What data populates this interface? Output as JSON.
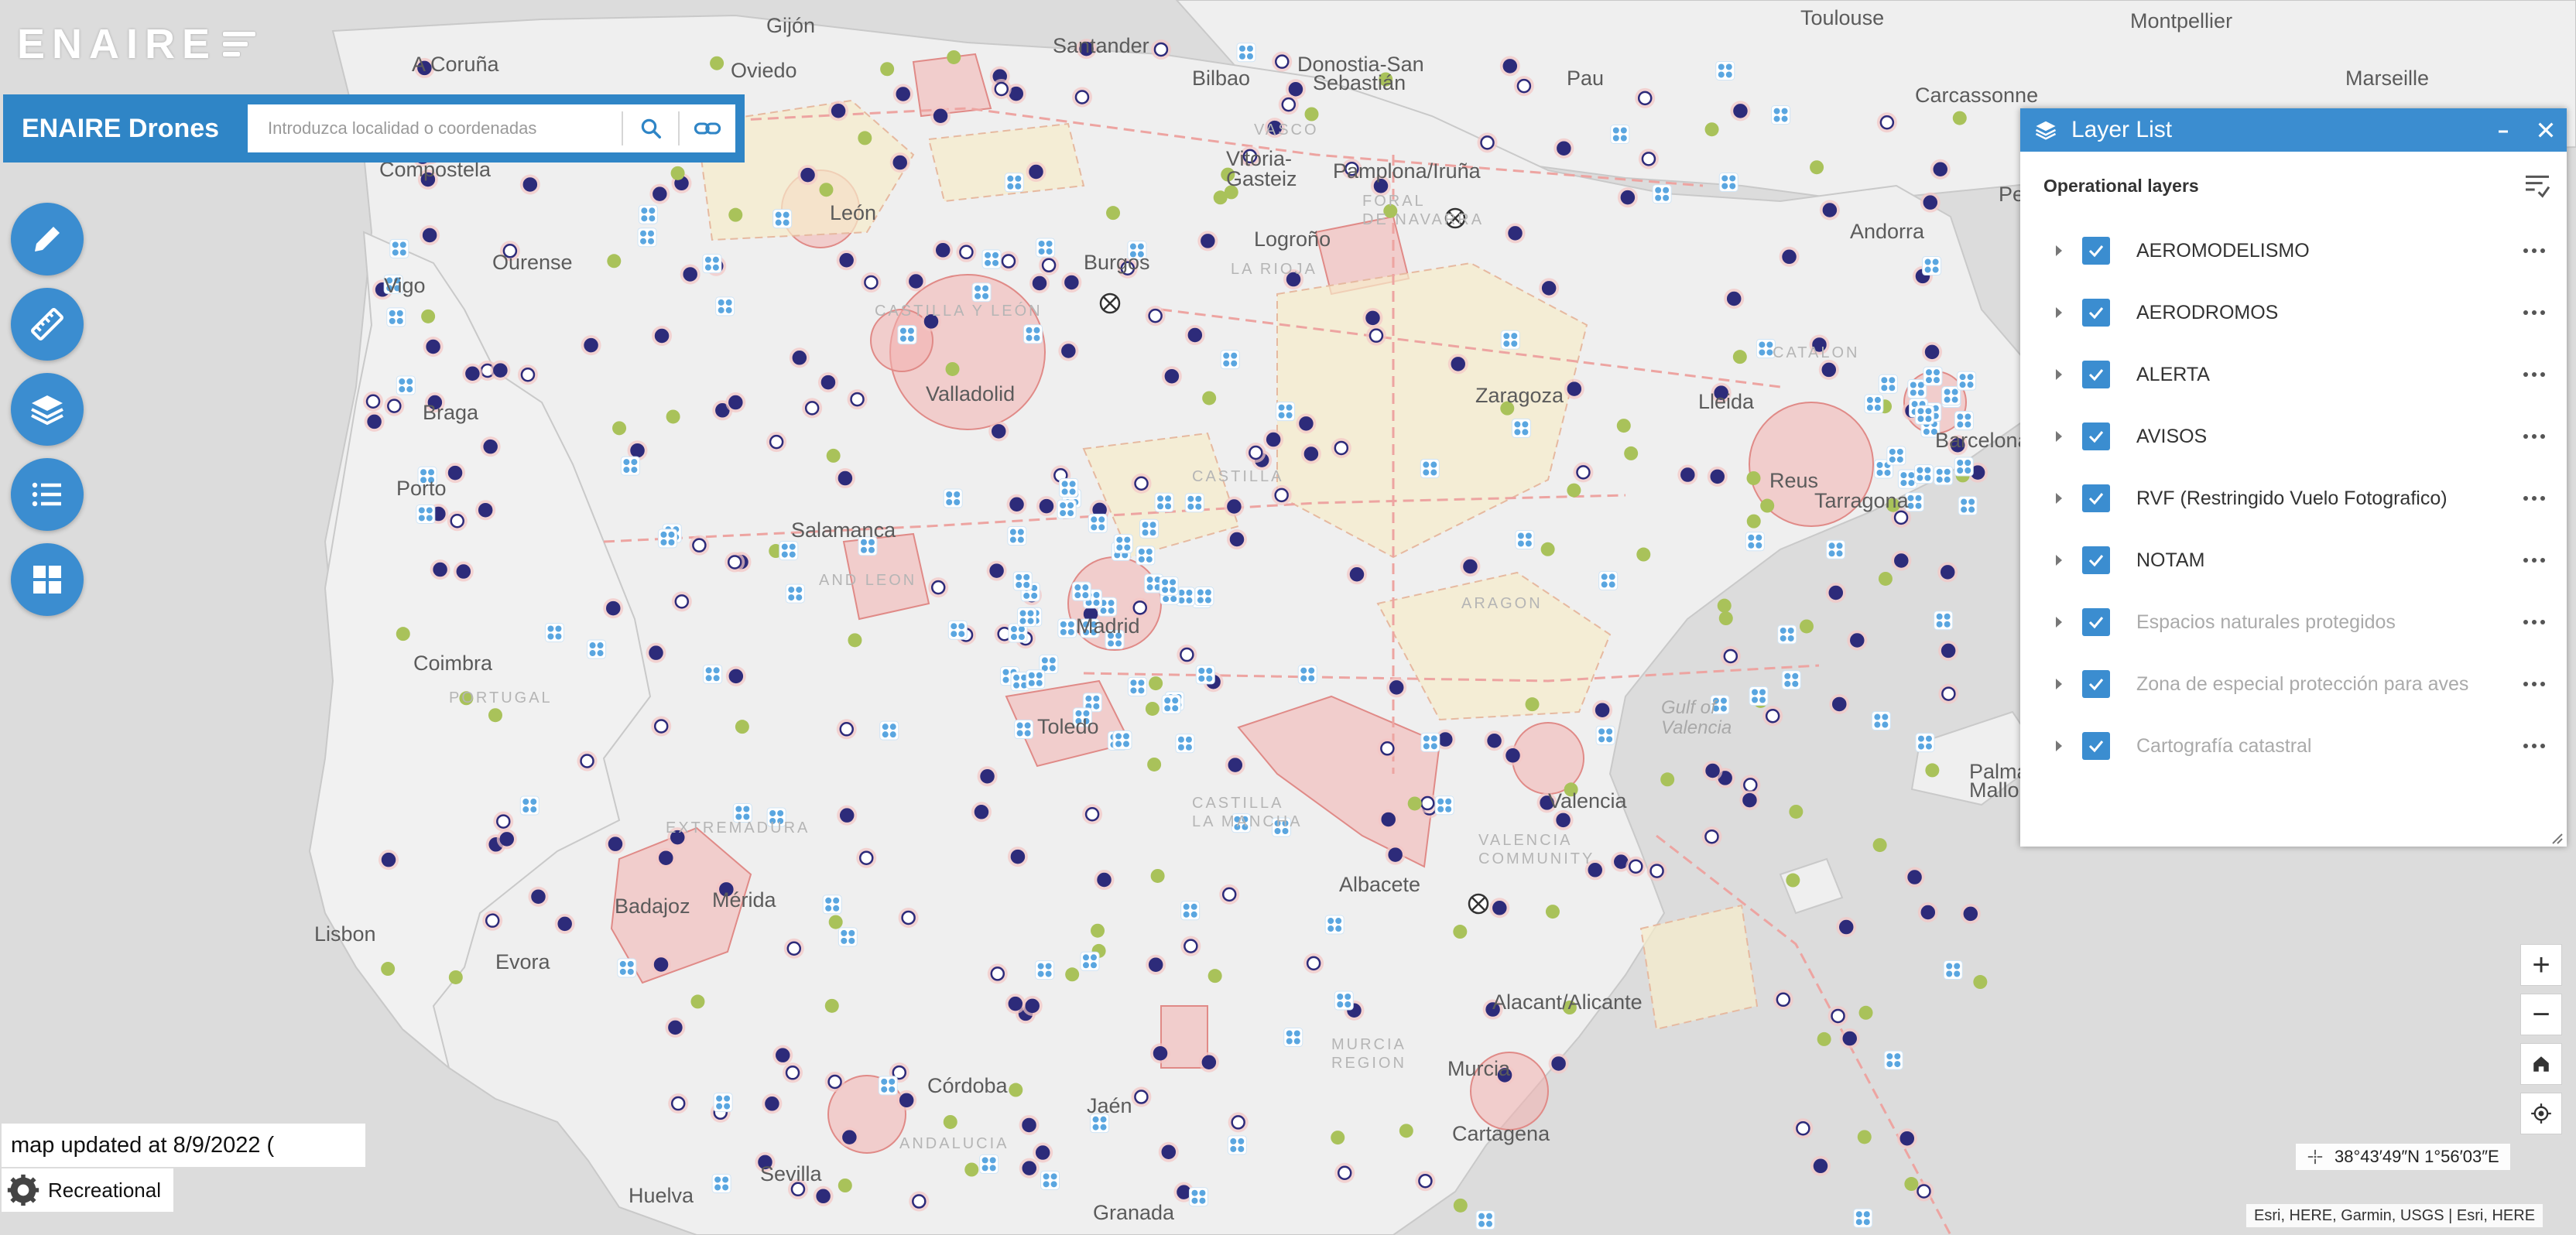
{
  "logo": {
    "text": "ENAIRE"
  },
  "app": {
    "title": "ENAIRE Drones"
  },
  "search": {
    "placeholder": "Introduzca localidad o coordenadas"
  },
  "tools": [
    {
      "name": "edit-pencil-icon"
    },
    {
      "name": "measure-ruler-icon"
    },
    {
      "name": "layers-icon"
    },
    {
      "name": "list-icon"
    },
    {
      "name": "grid-icon"
    }
  ],
  "layer_panel": {
    "title": "Layer List",
    "section": "Operational layers",
    "layers": [
      {
        "label": "AEROMODELISMO",
        "checked": true,
        "dim": false
      },
      {
        "label": "AERODROMOS",
        "checked": true,
        "dim": false
      },
      {
        "label": "ALERTA",
        "checked": true,
        "dim": false
      },
      {
        "label": "AVISOS",
        "checked": true,
        "dim": false
      },
      {
        "label": "RVF (Restringido Vuelo Fotografico)",
        "checked": true,
        "dim": false
      },
      {
        "label": "NOTAM",
        "checked": true,
        "dim": false
      },
      {
        "label": "Espacios naturales protegidos",
        "checked": true,
        "dim": true
      },
      {
        "label": "Zona de especial protección para aves",
        "checked": true,
        "dim": true
      },
      {
        "label": "Cartografía catastral",
        "checked": true,
        "dim": true
      }
    ]
  },
  "zoom": {
    "in": "+",
    "out": "−"
  },
  "coordinates": "38°43′49″N 1°56′03″E",
  "attribution": "Esri, HERE, Garmin, USGS | Esri, HERE",
  "map_updated": "map updated at  8/9/2022  (",
  "mode": "Recreational",
  "map_labels": {
    "cities": [
      "A Coruña",
      "Gijón",
      "Oviedo",
      "Santander",
      "Bilbao",
      "Donostia-San",
      "Sebastián",
      "Toulouse",
      "Montpellier",
      "Marseille",
      "Pau",
      "Carcassonne",
      "Andorra",
      "Compostela",
      "Ourense",
      "Vigo",
      "León",
      "Vitoria-",
      "Gasteiz",
      "Pamplona/Iruña",
      "Logroño",
      "Burgos",
      "Valladolid",
      "Zaragoza",
      "Lleida",
      "Barcelona",
      "Reus",
      "Tarragona",
      "Braga",
      "Porto",
      "Salamanca",
      "Madrid",
      "Coimbra",
      "Toledo",
      "Valencia",
      "Palma",
      "Mallo",
      "Badajoz",
      "Mérida",
      "Lisbon",
      "Evora",
      "Albacete",
      "Alacant/Alicante",
      "Córdoba",
      "Jaén",
      "Murcia",
      "Cartagena",
      "Sevilla",
      "Huelva",
      "Granada",
      "Pe"
    ],
    "regions": [
      "PORTUGAL",
      "CASTILLA Y LEÓN",
      "CASTILLA",
      "AND LEON",
      "LA RIOJA",
      "EXTREMADURA",
      "ANDALUCIA",
      "VALENCIA",
      "COMMUNITY",
      "MURCIA",
      "REGION",
      "CATALON",
      "CASTILLA",
      "LA MANCHA",
      "ARAGON",
      "VASCO",
      "FORAL",
      "DE NAVARRA"
    ],
    "sea": [
      "Gulf of",
      "Valencia"
    ]
  },
  "colors": {
    "accent": "#3b8dd0",
    "header": "#2f85c6",
    "zone_red": "#f1a8a8",
    "zone_yellow": "#f6eeca",
    "aerodrome": "#2d2b7a",
    "aeromodel": "#9ab94a",
    "drone": "#5aa6e0"
  }
}
